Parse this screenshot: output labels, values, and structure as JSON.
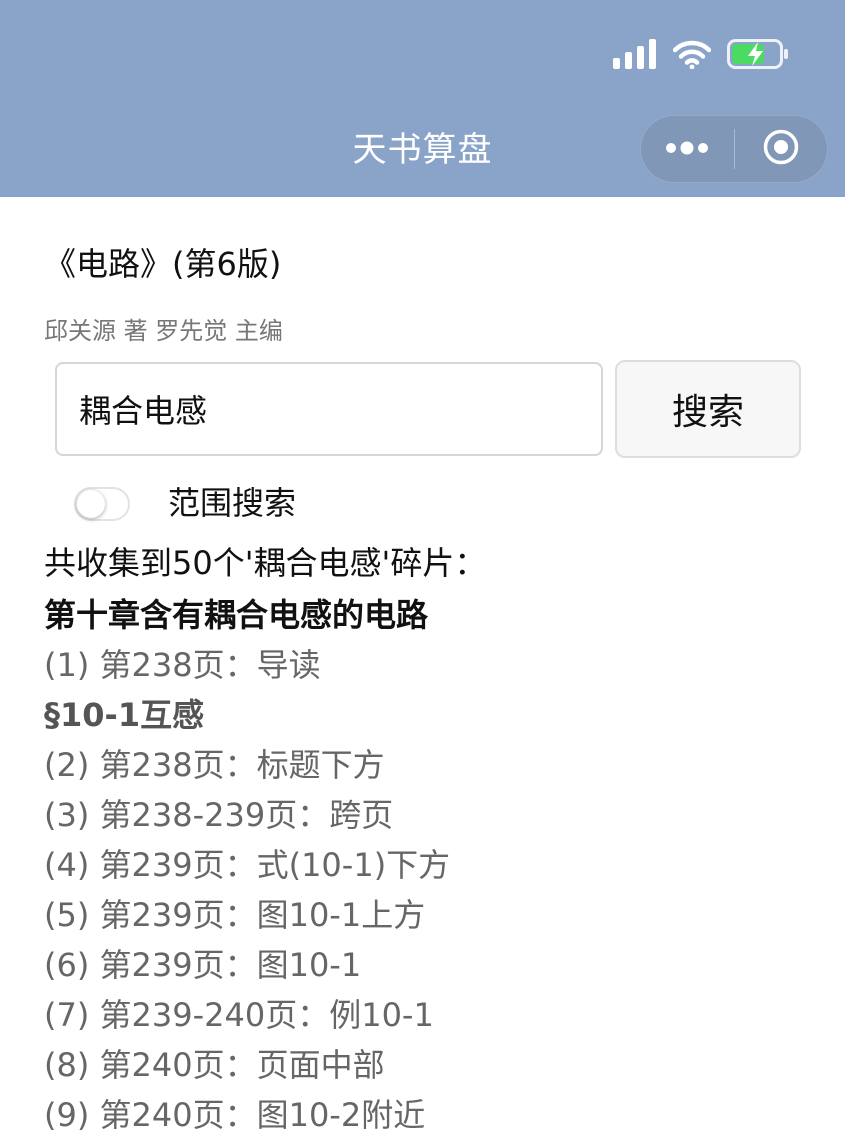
{
  "status_bar": {
    "icons": [
      "cellular-signal-icon",
      "wifi-icon",
      "battery-charging-icon"
    ]
  },
  "nav": {
    "title": "天书算盘",
    "menu_icon": "more-dots-icon",
    "close_icon": "target-circle-icon"
  },
  "book": {
    "title": "《电路》(第6版)",
    "author": "邱关源 著 罗先觉 主编"
  },
  "search": {
    "value": "耦合电感",
    "button_label": "搜索"
  },
  "range_toggle": {
    "label": "范围搜索",
    "enabled": false
  },
  "results": {
    "summary": "共收集到50个'耦合电感'碎片：",
    "items": [
      {
        "type": "chapter",
        "text": "第十章含有耦合电感的电路"
      },
      {
        "type": "entry",
        "text": "(1) 第238页：导读"
      },
      {
        "type": "section",
        "text": "§10-1互感"
      },
      {
        "type": "entry",
        "text": "(2) 第238页：标题下方"
      },
      {
        "type": "entry",
        "text": "(3) 第238-239页：跨页"
      },
      {
        "type": "entry",
        "text": "(4) 第239页：式(10-1)下方"
      },
      {
        "type": "entry",
        "text": "(5) 第239页：图10-1上方"
      },
      {
        "type": "entry",
        "text": "(6) 第239页：图10-1"
      },
      {
        "type": "entry",
        "text": "(7) 第239-240页：例10-1"
      },
      {
        "type": "entry",
        "text": "(8) 第240页：页面中部"
      },
      {
        "type": "entry",
        "text": "(9) 第240页：图10-2附近"
      }
    ]
  },
  "colors": {
    "header_bg": "#8aa4c9",
    "header_text": "#ffffff",
    "entry_text": "#666666",
    "heading_text": "#111111",
    "battery_fill": "#4cd964"
  }
}
